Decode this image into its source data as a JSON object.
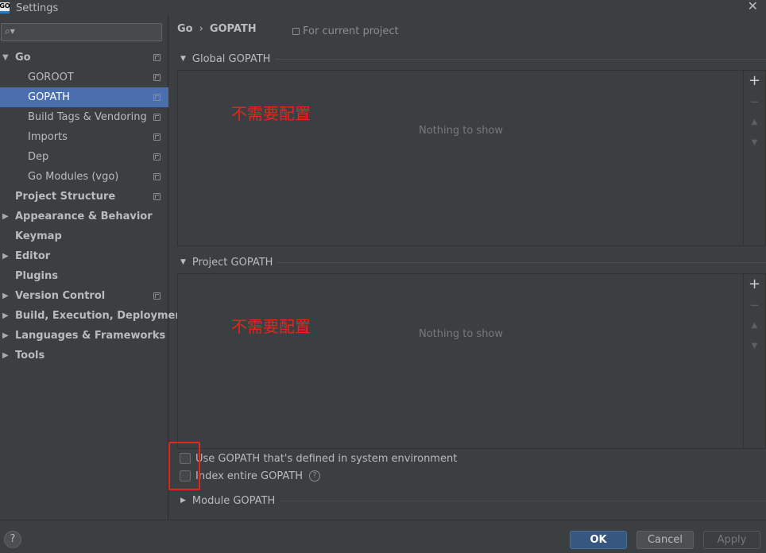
{
  "window": {
    "title": "Settings",
    "app_icon_text": "GO"
  },
  "sidebar": {
    "search": {
      "placeholder": "",
      "value": ""
    },
    "items": [
      {
        "label": "Go",
        "expanded": true
      },
      {
        "label": "GOROOT"
      },
      {
        "label": "GOPATH",
        "selected": true
      },
      {
        "label": "Build Tags & Vendoring"
      },
      {
        "label": "Imports"
      },
      {
        "label": "Dep"
      },
      {
        "label": "Go Modules (vgo)"
      },
      {
        "label": "Project Structure"
      },
      {
        "label": "Appearance & Behavior"
      },
      {
        "label": "Keymap"
      },
      {
        "label": "Editor"
      },
      {
        "label": "Plugins"
      },
      {
        "label": "Version Control"
      },
      {
        "label": "Build, Execution, Deployment"
      },
      {
        "label": "Languages & Frameworks"
      },
      {
        "label": "Tools"
      }
    ]
  },
  "main": {
    "breadcrumb": {
      "parent": "Go",
      "separator": "›",
      "current": "GOPATH"
    },
    "scope_label": "For current project",
    "global": {
      "header": "Global GOPATH",
      "empty_text": "Nothing to show",
      "annotation": "不需要配置"
    },
    "project": {
      "header": "Project GOPATH",
      "empty_text": "Nothing to show",
      "annotation": "不需要配置"
    },
    "toolbar": {
      "add": "+",
      "remove": "−",
      "up": "▲",
      "down": "▼"
    },
    "options": {
      "use_system_gopath": {
        "label": "Use GOPATH that's defined in system environment",
        "checked": false
      },
      "index_entire_gopath": {
        "label": "Index entire GOPATH",
        "checked": false
      }
    },
    "module": {
      "header": "Module GOPATH"
    }
  },
  "footer": {
    "help": "?",
    "ok_label": "OK",
    "cancel_label": "Cancel",
    "apply_label": "Apply"
  },
  "colors": {
    "background": "#3c3f41",
    "selection": "#4b6eaf",
    "ok_button": "#365880",
    "annotation_red": "#e8241c"
  }
}
